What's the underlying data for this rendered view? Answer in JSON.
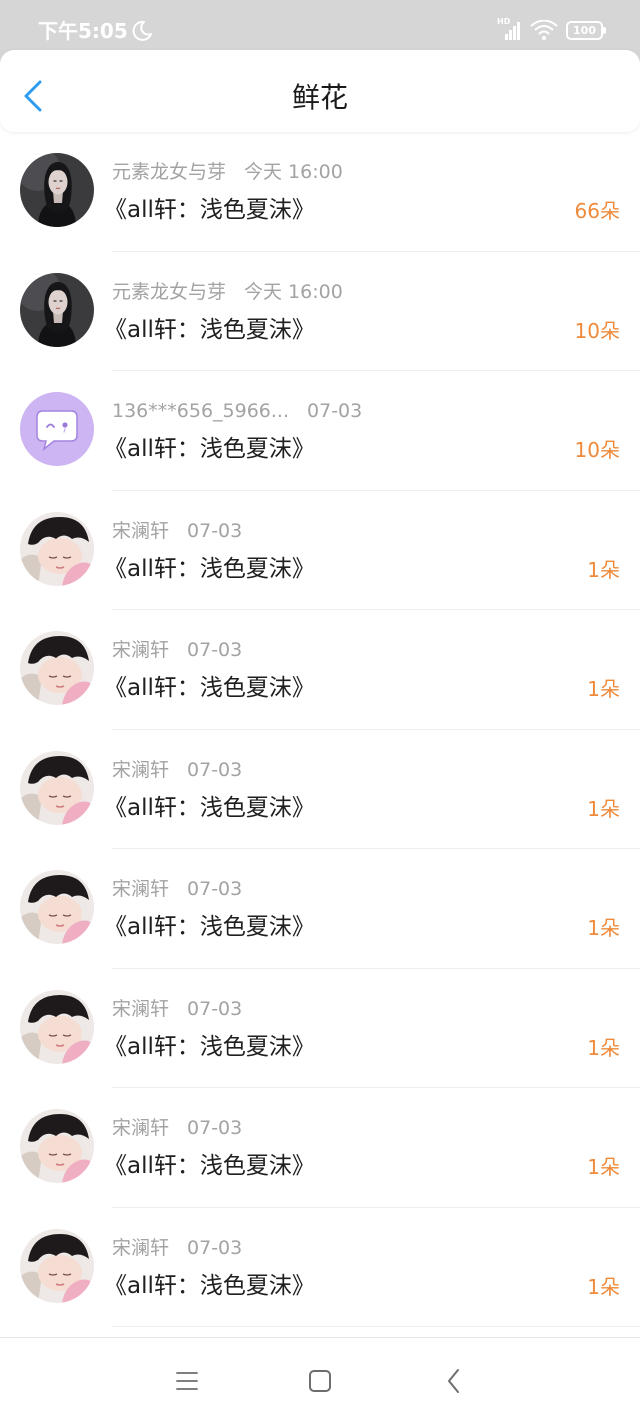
{
  "status_bar": {
    "time": "下午5:05",
    "network_label": "HD",
    "battery": "100",
    "icons": [
      "moon-icon",
      "signal-bars-icon",
      "wifi-icon",
      "battery-icon"
    ]
  },
  "header": {
    "title": "鲜花",
    "back_icon": "chevron-left-icon"
  },
  "colors": {
    "accent": "#2b9cf2",
    "count": "#ef8a3b",
    "meta_text": "#a3a3a3",
    "primary_text": "#1f1f1f",
    "status_bar_bg": "#d6d6d6"
  },
  "flowers": [
    {
      "avatar": "portrait-dark",
      "name": "元素龙女与芽",
      "time": "今天 16:00",
      "title": "《all轩：浅色夏沫》",
      "count": "66朵"
    },
    {
      "avatar": "portrait-dark",
      "name": "元素龙女与芽",
      "time": "今天 16:00",
      "title": "《all轩：浅色夏沫》",
      "count": "10朵"
    },
    {
      "avatar": "chat-bubble",
      "name": "136***656_5966...",
      "time": "07-03",
      "title": "《all轩：浅色夏沫》",
      "count": "10朵"
    },
    {
      "avatar": "portrait-light",
      "name": "宋澜轩",
      "time": "07-03",
      "title": "《all轩：浅色夏沫》",
      "count": "1朵"
    },
    {
      "avatar": "portrait-light",
      "name": "宋澜轩",
      "time": "07-03",
      "title": "《all轩：浅色夏沫》",
      "count": "1朵"
    },
    {
      "avatar": "portrait-light",
      "name": "宋澜轩",
      "time": "07-03",
      "title": "《all轩：浅色夏沫》",
      "count": "1朵"
    },
    {
      "avatar": "portrait-light",
      "name": "宋澜轩",
      "time": "07-03",
      "title": "《all轩：浅色夏沫》",
      "count": "1朵"
    },
    {
      "avatar": "portrait-light",
      "name": "宋澜轩",
      "time": "07-03",
      "title": "《all轩：浅色夏沫》",
      "count": "1朵"
    },
    {
      "avatar": "portrait-light",
      "name": "宋澜轩",
      "time": "07-03",
      "title": "《all轩：浅色夏沫》",
      "count": "1朵"
    },
    {
      "avatar": "portrait-light",
      "name": "宋澜轩",
      "time": "07-03",
      "title": "《all轩：浅色夏沫》",
      "count": "1朵"
    }
  ],
  "nav_bar": {
    "icons": [
      "menu-icon",
      "square-icon",
      "back-chevron-icon"
    ]
  }
}
